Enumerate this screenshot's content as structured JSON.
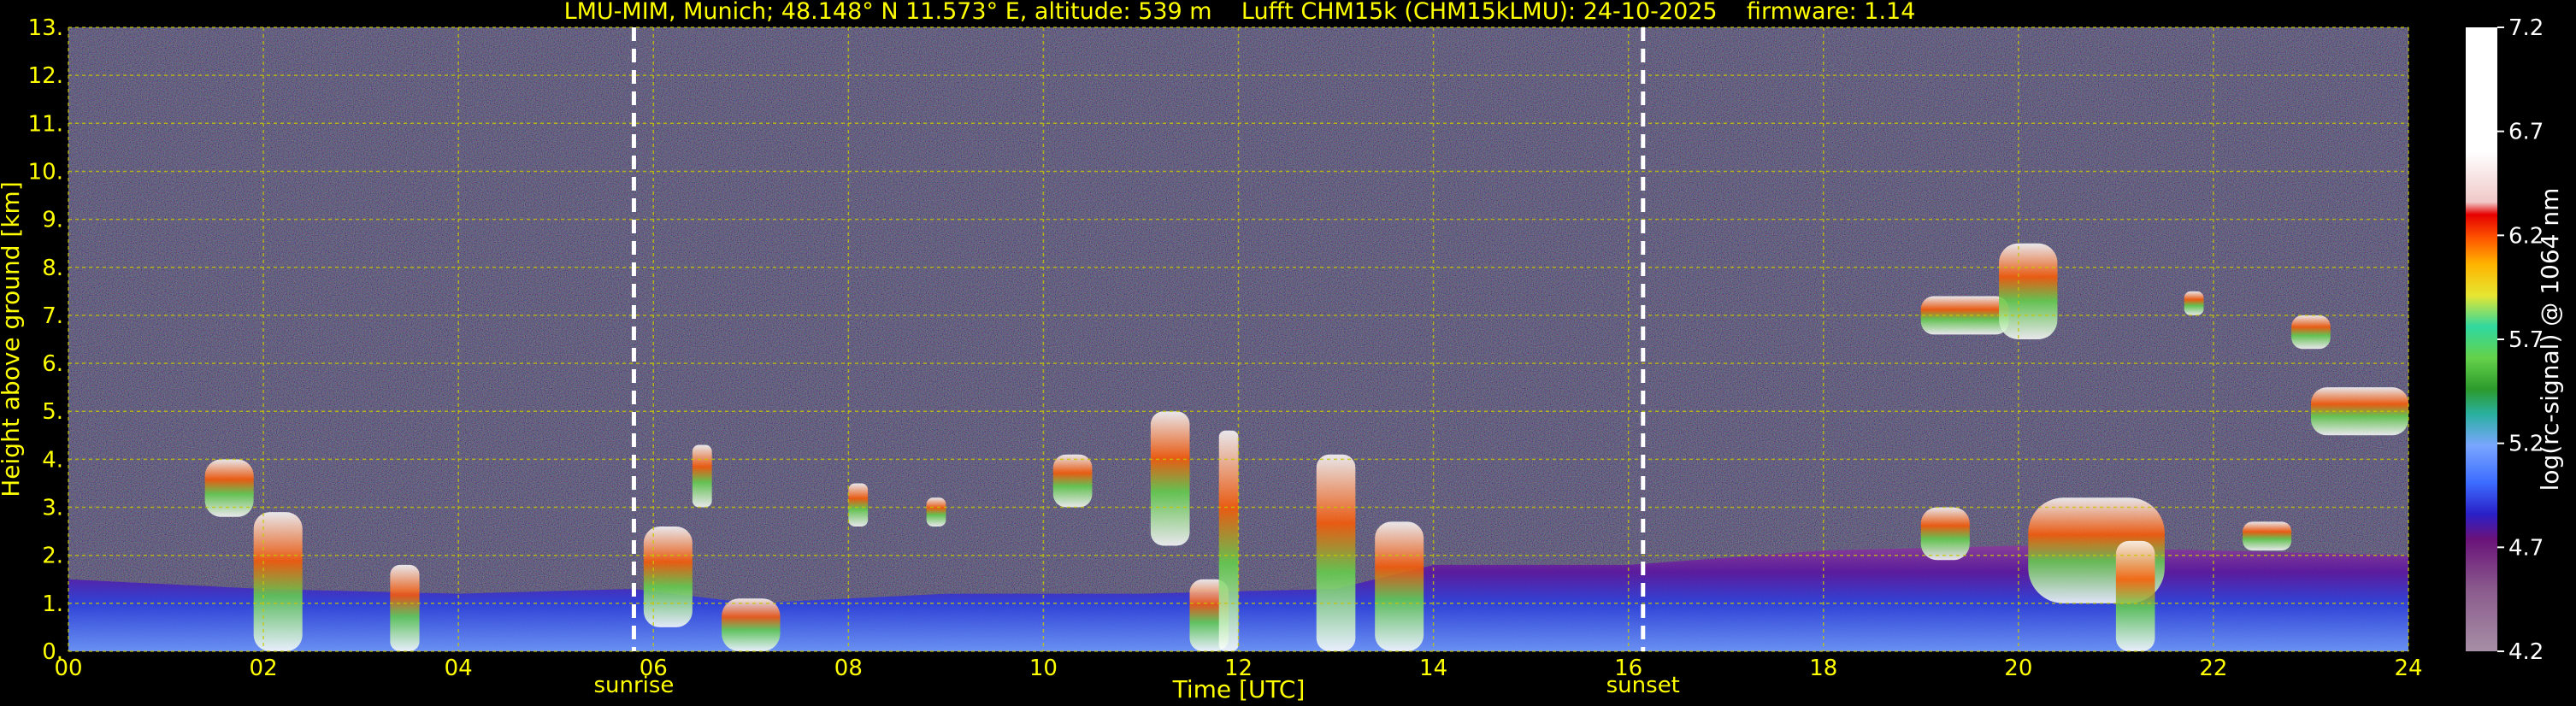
{
  "chart_data": {
    "type": "heatmap",
    "title": "LMU-MIM, Munich; 48.148° N 11.573° E, altitude: 539 m    Lufft CHM15k (CHM15kLMU): 24-10-2025    firmware: 1.14",
    "xlabel": "Time [UTC]",
    "ylabel": "Height above ground [km]",
    "xlim": [
      0,
      24
    ],
    "ylim": [
      0,
      13
    ],
    "x_ticks": [
      "00",
      "02",
      "04",
      "06",
      "08",
      "10",
      "12",
      "14",
      "16",
      "18",
      "20",
      "22",
      "24"
    ],
    "y_ticks": [
      "0.",
      "1.",
      "2.",
      "3.",
      "4.",
      "5.",
      "6.",
      "7.",
      "8.",
      "9.",
      "10.",
      "11.",
      "12.",
      "13."
    ],
    "grid": true,
    "colorbar": {
      "label": "log(rc-signal) @ 1064 nm",
      "range": [
        4.2,
        7.2
      ],
      "ticks": [
        "4.2",
        "4.7",
        "5.2",
        "5.7",
        "6.2",
        "6.7",
        "7.2"
      ]
    },
    "events": [
      {
        "name": "sunrise",
        "time": 5.8
      },
      {
        "name": "sunset",
        "time": 16.15
      }
    ],
    "boundary_layer_top_km": [
      [
        0,
        1.5
      ],
      [
        2,
        1.3
      ],
      [
        4,
        1.2
      ],
      [
        5.8,
        1.3
      ],
      [
        7,
        1.0
      ],
      [
        9,
        1.2
      ],
      [
        11,
        1.2
      ],
      [
        13,
        1.3
      ],
      [
        14,
        1.8
      ],
      [
        16,
        1.8
      ],
      [
        18,
        2.1
      ],
      [
        20,
        2.2
      ],
      [
        22,
        2.1
      ],
      [
        24,
        2.0
      ]
    ],
    "cloud_patches": [
      {
        "t_start": 1.4,
        "t_end": 1.9,
        "h_bottom": 2.8,
        "h_top": 4.0
      },
      {
        "t_start": 1.9,
        "t_end": 2.4,
        "h_bottom": 0.0,
        "h_top": 2.9
      },
      {
        "t_start": 3.3,
        "t_end": 3.6,
        "h_bottom": 0.0,
        "h_top": 1.8
      },
      {
        "t_start": 5.9,
        "t_end": 6.4,
        "h_bottom": 0.5,
        "h_top": 2.6
      },
      {
        "t_start": 6.4,
        "t_end": 6.6,
        "h_bottom": 3.0,
        "h_top": 4.3
      },
      {
        "t_start": 6.7,
        "t_end": 7.3,
        "h_bottom": 0.0,
        "h_top": 1.1
      },
      {
        "t_start": 8.0,
        "t_end": 8.2,
        "h_bottom": 2.6,
        "h_top": 3.5
      },
      {
        "t_start": 8.8,
        "t_end": 9.0,
        "h_bottom": 2.6,
        "h_top": 3.2
      },
      {
        "t_start": 10.1,
        "t_end": 10.5,
        "h_bottom": 3.0,
        "h_top": 4.1
      },
      {
        "t_start": 11.1,
        "t_end": 11.5,
        "h_bottom": 2.2,
        "h_top": 5.0
      },
      {
        "t_start": 11.5,
        "t_end": 11.9,
        "h_bottom": 0.0,
        "h_top": 1.5
      },
      {
        "t_start": 11.8,
        "t_end": 12.0,
        "h_bottom": 0.0,
        "h_top": 4.6
      },
      {
        "t_start": 12.8,
        "t_end": 13.2,
        "h_bottom": 0.0,
        "h_top": 4.1
      },
      {
        "t_start": 13.4,
        "t_end": 13.9,
        "h_bottom": 0.0,
        "h_top": 2.7
      },
      {
        "t_start": 19.0,
        "t_end": 19.5,
        "h_bottom": 1.9,
        "h_top": 3.0
      },
      {
        "t_start": 19.0,
        "t_end": 19.9,
        "h_bottom": 6.6,
        "h_top": 7.4
      },
      {
        "t_start": 19.8,
        "t_end": 20.4,
        "h_bottom": 6.5,
        "h_top": 8.5
      },
      {
        "t_start": 20.1,
        "t_end": 21.5,
        "h_bottom": 1.0,
        "h_top": 3.2
      },
      {
        "t_start": 21.0,
        "t_end": 21.4,
        "h_bottom": 0.0,
        "h_top": 2.3
      },
      {
        "t_start": 21.7,
        "t_end": 21.9,
        "h_bottom": 7.0,
        "h_top": 7.5
      },
      {
        "t_start": 22.3,
        "t_end": 22.8,
        "h_bottom": 2.1,
        "h_top": 2.7
      },
      {
        "t_start": 22.8,
        "t_end": 23.2,
        "h_bottom": 6.3,
        "h_top": 7.0
      },
      {
        "t_start": 23.0,
        "t_end": 24.0,
        "h_bottom": 4.5,
        "h_top": 5.5
      }
    ]
  },
  "colors": {
    "background": "#000000",
    "text": "#ffff00",
    "grid": "#c8c800",
    "event_line": "#ffffff",
    "colorbar_stops": [
      "#a78fa6",
      "#8a5a8c",
      "#6a127a",
      "#2a20c8",
      "#3c6cff",
      "#7aa6ff",
      "#2ab0a0",
      "#2c9a2c",
      "#64d24a",
      "#30d8a0",
      "#e6e632",
      "#ffb400",
      "#ff5a00",
      "#e60000",
      "#f0c8c8",
      "#ffffff"
    ]
  }
}
